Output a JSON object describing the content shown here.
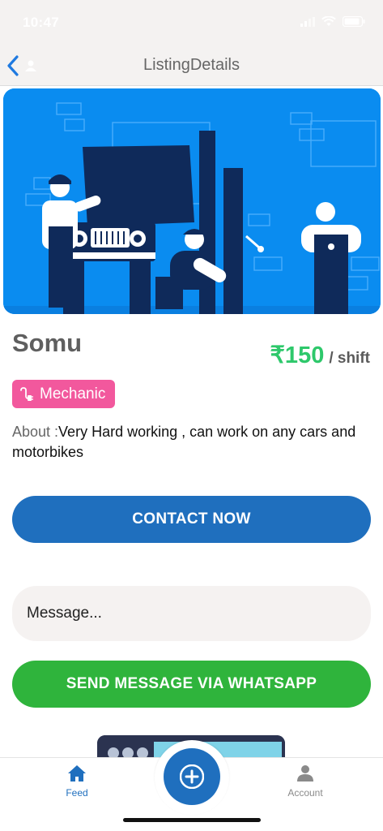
{
  "status_bar": {
    "time": "10:47"
  },
  "nav": {
    "title": "ListingDetails"
  },
  "listing": {
    "name": "Somu",
    "price": "₹150",
    "price_unit": "/ shift",
    "category": "Mechanic",
    "about_label": "About :",
    "about_text": "Very Hard working , can work on any cars and motorbikes"
  },
  "actions": {
    "contact_label": "CONTACT NOW",
    "message_placeholder": "Message...",
    "whatsapp_label": "SEND MESSAGE VIA WHATSAPP"
  },
  "tab_bar": {
    "feed_label": "Feed",
    "account_label": "Account"
  },
  "colors": {
    "primary": "#1f6fbe",
    "price_green": "#2ec86b",
    "whatsapp_green": "#2fb43c",
    "category_pink": "#f2589d",
    "hero_blue": "#0a8cf0"
  },
  "icons": [
    "back-chevron-icon",
    "user-icon",
    "signal-icon",
    "wifi-icon",
    "battery-icon",
    "plug-icon",
    "home-icon",
    "plus-icon",
    "account-icon"
  ]
}
